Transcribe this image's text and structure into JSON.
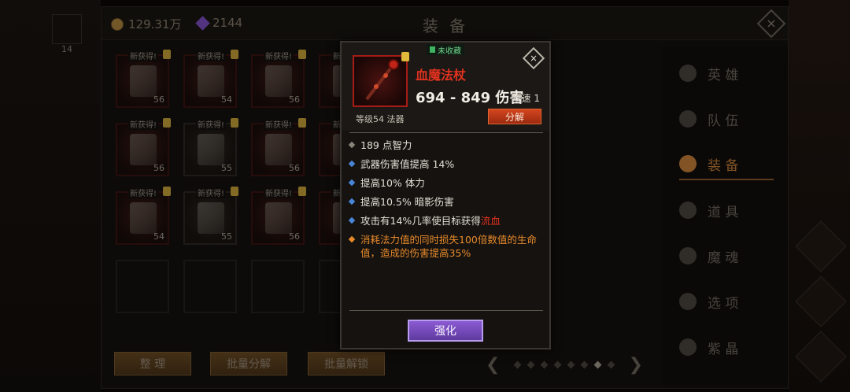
{
  "hero": {
    "level": "14"
  },
  "topbar": {
    "gold": "129.31万",
    "gems": "2144",
    "title": "装 备",
    "close_glyph": "×"
  },
  "slots": [
    {
      "new": "新获得!",
      "level": "56",
      "style": "red",
      "locked": true
    },
    {
      "new": "新获得!",
      "level": "54",
      "style": "red",
      "locked": true
    },
    {
      "new": "新获得!",
      "level": "56",
      "style": "red",
      "locked": true
    },
    {
      "new": "新获得!",
      "level": "56",
      "style": "red",
      "locked": true
    },
    {
      "new": "新获得!",
      "level": "55",
      "style": "red",
      "locked": true
    },
    {
      "new": "新获得!",
      "level": "55",
      "style": "red",
      "locked": true
    },
    {
      "new": "新获得!",
      "level": "56",
      "style": "red",
      "locked": true
    },
    {
      "new": "新获得!",
      "level": "55",
      "style": "gray",
      "locked": true
    },
    {
      "new": "新获得!",
      "level": "56",
      "style": "red",
      "locked": true
    },
    {
      "new": "新获得!",
      "level": "56",
      "style": "red",
      "locked": true
    },
    {
      "new": "新获得!",
      "level": "56",
      "style": "red",
      "locked": true
    },
    {
      "new": "新获得!",
      "level": "56",
      "style": "red",
      "locked": true
    },
    {
      "new": "新获得!",
      "level": "54",
      "style": "red",
      "locked": true
    },
    {
      "new": "新获得!",
      "level": "55",
      "style": "gray",
      "locked": true
    },
    {
      "new": "新获得!",
      "level": "56",
      "style": "red",
      "locked": true
    },
    {
      "new": "新获得!",
      "level": "56",
      "style": "red",
      "locked": true
    }
  ],
  "sidebar": {
    "items": [
      {
        "label": "英 雄",
        "icon": "hero-icon"
      },
      {
        "label": "队 伍",
        "icon": "flag-icon"
      },
      {
        "label": "装 备",
        "icon": "helmet-icon",
        "active": true
      },
      {
        "label": "道 具",
        "icon": "bag-icon"
      },
      {
        "label": "魔 魂",
        "icon": "flame-icon"
      },
      {
        "label": "选 项",
        "icon": "gear-icon"
      },
      {
        "label": "紫 晶",
        "icon": "gem-icon"
      }
    ]
  },
  "bottom": {
    "sort_label": "整 理",
    "batch_dismantle_label": "批量分解",
    "batch_unlock_label": "批量解锁",
    "pager": {
      "prev": "❮",
      "next": "❯",
      "pages": 8,
      "current": 7
    }
  },
  "tooltip": {
    "fav_tag": "未收藏",
    "name": "血魔法杖",
    "damage": "694 - 849 伤害",
    "speed": "攻速 1",
    "level_class": "等级54 法器",
    "dismantle_label": "分解",
    "close_glyph": "×",
    "stats": [
      {
        "text": "189 点智力",
        "kind": "base"
      },
      {
        "text": "武器伤害值提高 14%",
        "kind": "blue"
      },
      {
        "text": "提高10% 体力",
        "kind": "blue"
      },
      {
        "text": "提高10.5% 暗影伤害",
        "kind": "blue"
      },
      {
        "text_before": "攻击有14%几率使目标获得",
        "text_bleed": "流血",
        "kind": "blue"
      },
      {
        "text": "消耗法力值的同时损失100倍数值的生命值，造成的伤害提高35%",
        "kind": "orange"
      }
    ],
    "enhance_label": "强化"
  },
  "colors": {
    "item_name_red": "#e0321f",
    "legendary_orange": "#e88a2a",
    "magic_blue": "#4a86d8",
    "enhance_purple": "#8b5ad2"
  }
}
